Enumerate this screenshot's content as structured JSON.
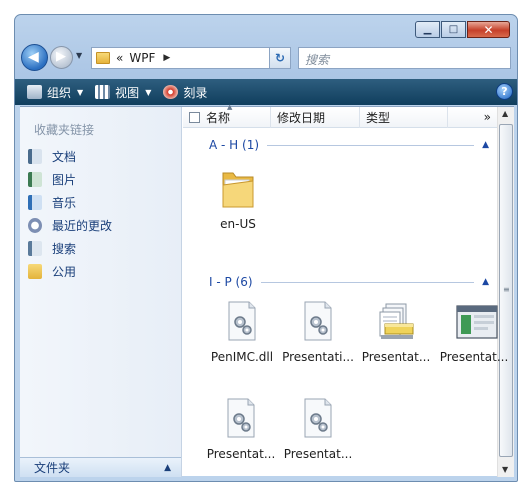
{
  "window": {
    "caption_buttons": [
      {
        "name": "minimize-button",
        "glyph": "▁"
      },
      {
        "name": "maximize-button",
        "glyph": "□"
      },
      {
        "name": "close-button",
        "glyph": "✕"
      }
    ]
  },
  "navigation": {
    "address_prefix": "«",
    "address_path": "WPF",
    "address_separator": "▶",
    "search_placeholder": "搜索"
  },
  "toolbar": {
    "organize": "组织",
    "views": "视图",
    "burn": "刻录"
  },
  "nav_pane": {
    "header": "收藏夹链接",
    "items": [
      {
        "label": "文档",
        "icon": "documents-icon",
        "color": "#4a6b8c"
      },
      {
        "label": "图片",
        "icon": "pictures-icon",
        "color": "#3c7a52"
      },
      {
        "label": "音乐",
        "icon": "music-icon",
        "color": "#2f6fb6"
      },
      {
        "label": "最近的更改",
        "icon": "recent-changes-icon",
        "color": "#7d8fb3"
      },
      {
        "label": "搜索",
        "icon": "search-icon",
        "color": "#5a7a9a"
      },
      {
        "label": "公用",
        "icon": "public-folder-icon",
        "color": "#e3b33b"
      }
    ],
    "folders_label": "文件夹"
  },
  "columns": {
    "name": "名称",
    "modified": "修改日期",
    "type": "类型",
    "more": "»"
  },
  "groups": [
    {
      "label": "A - H (1)",
      "files": [
        {
          "label": "en-US",
          "icon": "folder-icon"
        }
      ]
    },
    {
      "label": "I - P (6)",
      "files": [
        {
          "label": "PenIMC.dll",
          "icon": "dll-file-icon"
        },
        {
          "label": "Presentati...",
          "icon": "dll-file-icon"
        },
        {
          "label": "Presentat...",
          "icon": "package-file-icon"
        },
        {
          "label": "Presentat...",
          "icon": "window-file-icon"
        },
        {
          "label": "Presentat...",
          "icon": "dll-file-icon"
        },
        {
          "label": "Presentat...",
          "icon": "dll-file-icon"
        }
      ]
    }
  ]
}
